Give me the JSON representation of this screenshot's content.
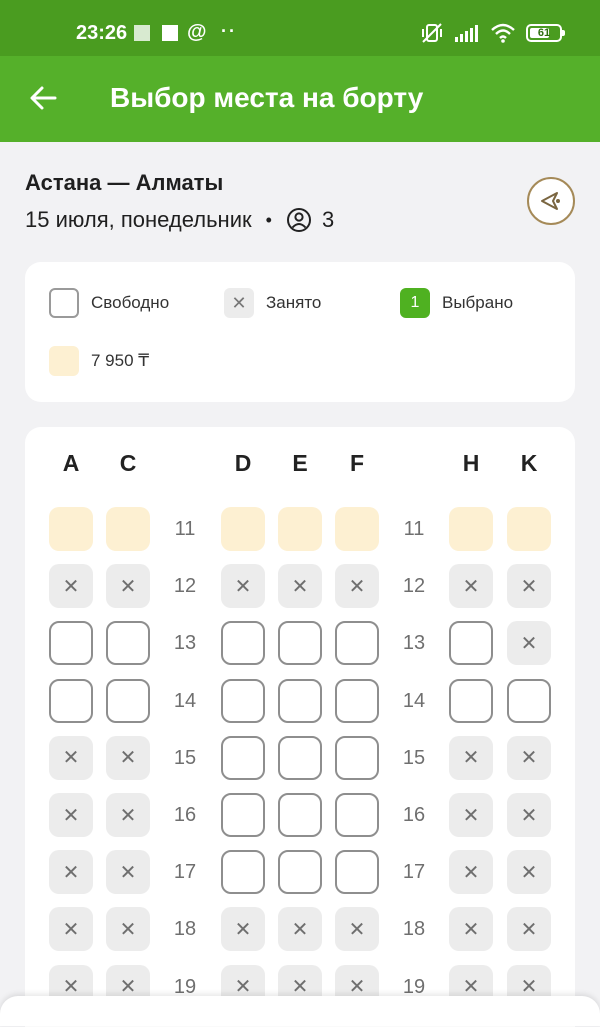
{
  "status_bar": {
    "time": "23:26",
    "at_sign": "@",
    "dots": "··",
    "battery": "61"
  },
  "header": {
    "title": "Выбор места на борту"
  },
  "trip": {
    "route": "Астана — Алматы",
    "date": "15 июля, понедельник",
    "separator": "•",
    "passengers": "3"
  },
  "legend": {
    "free": "Свободно",
    "occupied": "Занято",
    "selected_badge": "1",
    "selected": "Выбрано",
    "price": "7 950 ₸"
  },
  "seat_map": {
    "columns": [
      "A",
      "C",
      "D",
      "E",
      "F",
      "H",
      "K"
    ],
    "occupied_mark": "✕",
    "rows": [
      {
        "num": "11",
        "seats": [
          "price",
          "price",
          "price",
          "price",
          "price",
          "price",
          "price"
        ]
      },
      {
        "num": "12",
        "seats": [
          "occ",
          "occ",
          "occ",
          "occ",
          "occ",
          "occ",
          "occ"
        ]
      },
      {
        "num": "13",
        "seats": [
          "free",
          "free",
          "free",
          "free",
          "free",
          "free",
          "occ"
        ]
      },
      {
        "num": "14",
        "seats": [
          "free",
          "free",
          "free",
          "free",
          "free",
          "free",
          "free"
        ]
      },
      {
        "num": "15",
        "seats": [
          "occ",
          "occ",
          "free",
          "free",
          "free",
          "occ",
          "occ"
        ]
      },
      {
        "num": "16",
        "seats": [
          "occ",
          "occ",
          "free",
          "free",
          "free",
          "occ",
          "occ"
        ]
      },
      {
        "num": "17",
        "seats": [
          "occ",
          "occ",
          "free",
          "free",
          "free",
          "occ",
          "occ"
        ]
      },
      {
        "num": "18",
        "seats": [
          "occ",
          "occ",
          "occ",
          "occ",
          "occ",
          "occ",
          "occ"
        ]
      },
      {
        "num": "19",
        "seats": [
          "occ",
          "occ",
          "occ",
          "occ",
          "occ",
          "occ",
          "occ"
        ]
      }
    ]
  },
  "colors": {
    "status_bar": "#4a9c20",
    "app_bar": "#55b02a",
    "selected": "#4fb121",
    "price_seat": "#fdf0d2",
    "occupied_seat": "#ececec"
  }
}
